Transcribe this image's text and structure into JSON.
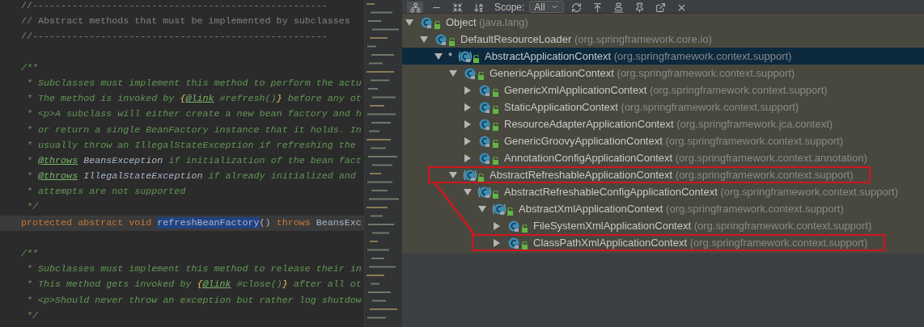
{
  "editor": {
    "lines": [
      {
        "kind": "code",
        "current": false,
        "segments": [
          {
            "text": "//----------------------------------------------------",
            "kind": "comment"
          }
        ]
      },
      {
        "kind": "code",
        "current": false,
        "segments": [
          {
            "text": "// Abstract methods that must be implemented by subclasses",
            "kind": "comment"
          }
        ]
      },
      {
        "kind": "code",
        "current": false,
        "segments": [
          {
            "text": "//----------------------------------------------------",
            "kind": "comment"
          }
        ]
      },
      {
        "kind": "blank",
        "current": false
      },
      {
        "kind": "code",
        "current": false,
        "segments": [
          {
            "text": "/**",
            "kind": "doc"
          }
        ]
      },
      {
        "kind": "code",
        "current": false,
        "segments": [
          {
            "text": " * Subclasses must implement this method to perform the actu",
            "kind": "doc"
          }
        ]
      },
      {
        "kind": "code",
        "current": false,
        "segments": [
          {
            "text": " * The method is invoked by ",
            "kind": "doc"
          },
          {
            "text": "{",
            "kind": "brace"
          },
          {
            "text": "@link",
            "kind": "tag"
          },
          {
            "text": " #refresh()",
            "kind": "doc"
          },
          {
            "text": "}",
            "kind": "brace"
          },
          {
            "text": " before any ot",
            "kind": "doc"
          }
        ]
      },
      {
        "kind": "code",
        "current": false,
        "segments": [
          {
            "text": " * <p>A subclass will either create a new bean factory and h",
            "kind": "doc"
          }
        ]
      },
      {
        "kind": "code",
        "current": false,
        "segments": [
          {
            "text": " * or return a single BeanFactory instance that it holds. In",
            "kind": "doc"
          }
        ]
      },
      {
        "kind": "code",
        "current": false,
        "segments": [
          {
            "text": " * usually throw an IllegalStateException if refreshing the",
            "kind": "doc"
          }
        ]
      },
      {
        "kind": "code",
        "current": false,
        "segments": [
          {
            "text": " * ",
            "kind": "doc"
          },
          {
            "text": "@throws",
            "kind": "tag"
          },
          {
            "text": " BeansException",
            "kind": "type"
          },
          {
            "text": " if initialization of the bean fact",
            "kind": "doc"
          }
        ]
      },
      {
        "kind": "code",
        "current": false,
        "segments": [
          {
            "text": " * ",
            "kind": "doc"
          },
          {
            "text": "@throws",
            "kind": "tag"
          },
          {
            "text": " IllegalStateException",
            "kind": "type"
          },
          {
            "text": " if already initialized and",
            "kind": "doc"
          }
        ]
      },
      {
        "kind": "code",
        "current": false,
        "segments": [
          {
            "text": " * attempts are not supported",
            "kind": "doc"
          }
        ]
      },
      {
        "kind": "code",
        "current": false,
        "segments": [
          {
            "text": " */",
            "kind": "doc"
          }
        ]
      },
      {
        "kind": "code",
        "current": true,
        "segments": [
          {
            "text": "protected abstract void ",
            "kind": "keyword"
          },
          {
            "text": "refreshBeanFactory",
            "kind": "selected"
          },
          {
            "text": "() ",
            "kind": "plain"
          },
          {
            "text": "throws ",
            "kind": "keyword"
          },
          {
            "text": "BeansExc",
            "kind": "plain"
          }
        ]
      },
      {
        "kind": "blank",
        "current": false
      },
      {
        "kind": "code",
        "current": false,
        "segments": [
          {
            "text": "/**",
            "kind": "doc"
          }
        ]
      },
      {
        "kind": "code",
        "current": false,
        "segments": [
          {
            "text": " * Subclasses must implement this method to release their in",
            "kind": "doc"
          }
        ]
      },
      {
        "kind": "code",
        "current": false,
        "segments": [
          {
            "text": " * This method gets invoked by ",
            "kind": "doc"
          },
          {
            "text": "{",
            "kind": "brace"
          },
          {
            "text": "@link",
            "kind": "tag"
          },
          {
            "text": " #close()",
            "kind": "doc"
          },
          {
            "text": "}",
            "kind": "brace"
          },
          {
            "text": " after all ot",
            "kind": "doc"
          }
        ]
      },
      {
        "kind": "code",
        "current": false,
        "segments": [
          {
            "text": " * <p>Should never throw an exception but rather log shutdow",
            "kind": "doc"
          }
        ]
      },
      {
        "kind": "code",
        "current": false,
        "segments": [
          {
            "text": " */",
            "kind": "doc"
          }
        ]
      }
    ]
  },
  "hierarchy": {
    "toolbar": [
      {
        "kind": "hierarchy",
        "selected": true
      },
      {
        "kind": "bar",
        "selected": false
      },
      {
        "kind": "collapse",
        "selected": false
      },
      {
        "kind": "sort",
        "selected": false
      }
    ],
    "scope_label": "Scope:",
    "scope_value": "All",
    "toolbar_end": [
      {
        "kind": "refresh"
      },
      {
        "kind": "up"
      },
      {
        "kind": "align"
      },
      {
        "kind": "pin"
      },
      {
        "kind": "export"
      },
      {
        "kind": "close"
      }
    ],
    "tree": [
      {
        "name": "Object",
        "package": "(java.lang)",
        "kind": "class",
        "expanded": true,
        "selected": false,
        "annotated": false,
        "children": [
          {
            "name": "DefaultResourceLoader",
            "package": "(org.springframework.core.io)",
            "kind": "class",
            "expanded": true,
            "selected": false,
            "annotated": false,
            "children": [
              {
                "name": "AbstractApplicationContext",
                "package": "(org.springframework.context.support)",
                "kind": "abstract",
                "marker": "*",
                "expanded": true,
                "selected": true,
                "annotated": false,
                "children": [
                  {
                    "name": "GenericApplicationContext",
                    "package": "(org.springframework.context.support)",
                    "kind": "class",
                    "expanded": true,
                    "selected": false,
                    "annotated": false,
                    "children": [
                      {
                        "name": "GenericXmlApplicationContext",
                        "package": "(org.springframework.context.support)",
                        "kind": "class",
                        "expanded": false,
                        "selected": false,
                        "annotated": false
                      },
                      {
                        "name": "StaticApplicationContext",
                        "package": "(org.springframework.context.support)",
                        "kind": "class",
                        "expanded": false,
                        "selected": false,
                        "annotated": false
                      },
                      {
                        "name": "ResourceAdapterApplicationContext",
                        "package": "(org.springframework.jca.context)",
                        "kind": "class",
                        "expanded": false,
                        "selected": false,
                        "annotated": false
                      },
                      {
                        "name": "GenericGroovyApplicationContext",
                        "package": "(org.springframework.context.support)",
                        "kind": "class",
                        "expanded": false,
                        "selected": false,
                        "annotated": false
                      },
                      {
                        "name": "AnnotationConfigApplicationContext",
                        "package": "(org.springframework.context.annotation)",
                        "kind": "class",
                        "expanded": false,
                        "selected": false,
                        "annotated": false
                      }
                    ]
                  },
                  {
                    "name": "AbstractRefreshableApplicationContext",
                    "package": "(org.springframework.context.support)",
                    "kind": "abstract",
                    "expanded": true,
                    "selected": false,
                    "annotated": true,
                    "children": [
                      {
                        "name": "AbstractRefreshableConfigApplicationContext",
                        "package": "(org.springframework.context.support)",
                        "kind": "abstract",
                        "expanded": true,
                        "selected": false,
                        "annotated": false,
                        "children": [
                          {
                            "name": "AbstractXmlApplicationContext",
                            "package": "(org.springframework.context.support)",
                            "kind": "abstract",
                            "expanded": true,
                            "selected": false,
                            "annotated": false,
                            "children": [
                              {
                                "name": "FileSystemXmlApplicationContext",
                                "package": "(org.springframework.context.support)",
                                "kind": "class",
                                "expanded": false,
                                "selected": false,
                                "annotated": false
                              },
                              {
                                "name": "ClassPathXmlApplicationContext",
                                "package": "(org.springframework.context.support)",
                                "kind": "class",
                                "expanded": false,
                                "selected": false,
                                "annotated": true
                              }
                            ]
                          }
                        ]
                      }
                    ]
                  }
                ]
              }
            ]
          }
        ]
      }
    ]
  }
}
